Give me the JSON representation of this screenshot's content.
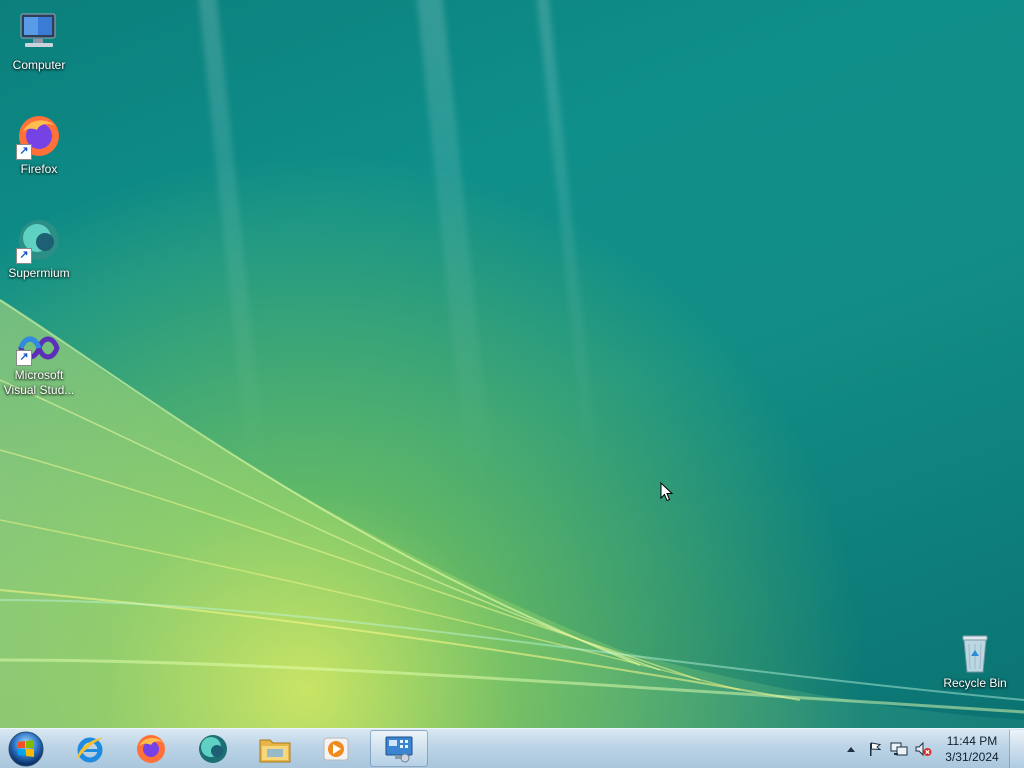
{
  "desktop": {
    "icons": [
      {
        "label": "Computer",
        "icon": "computer-icon"
      },
      {
        "label": "Firefox",
        "icon": "firefox-icon",
        "shortcut": true
      },
      {
        "label": "Supermium",
        "icon": "supermium-icon",
        "shortcut": true
      },
      {
        "label": "Microsoft Visual Stud...",
        "icon": "visual-studio-icon",
        "shortcut": true
      },
      {
        "label": "Recycle Bin",
        "icon": "recycle-bin-icon"
      }
    ]
  },
  "taskbar": {
    "start": {
      "icon": "windows-start-orb-icon"
    },
    "pinned": [
      {
        "icon": "internet-explorer-icon"
      },
      {
        "icon": "firefox-icon"
      },
      {
        "icon": "supermium-icon"
      },
      {
        "icon": "file-explorer-icon"
      },
      {
        "icon": "media-player-icon"
      },
      {
        "icon": "control-panel-icon",
        "active": true
      }
    ],
    "tray": {
      "icons": [
        "show-hidden-icons-arrow",
        "action-center-flag-icon",
        "network-icon",
        "volume-muted-icon"
      ],
      "time": "11:44 PM",
      "date": "3/31/2024"
    }
  },
  "colors": {
    "taskbar_top": "#d9e8f3",
    "taskbar_bottom": "#a9c6dc",
    "wallpaper_teal": "#0f8f8a",
    "wallpaper_green": "#b6df5a"
  }
}
